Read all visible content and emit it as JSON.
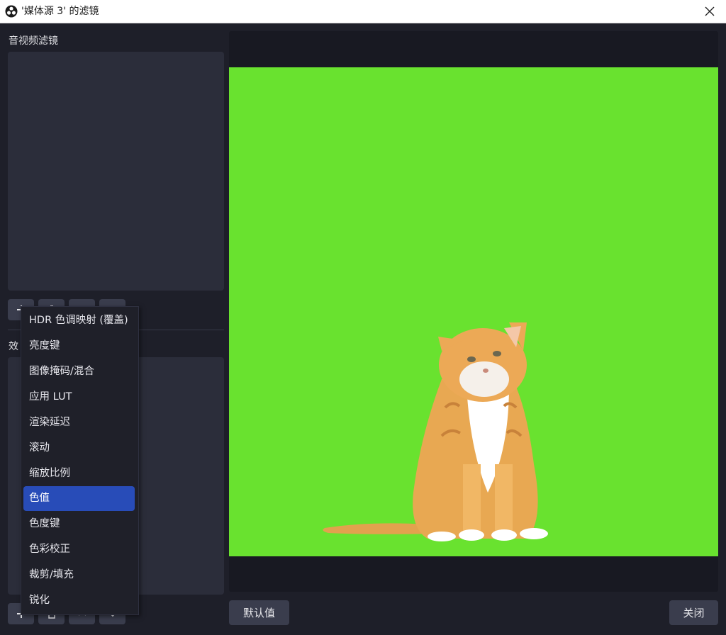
{
  "window": {
    "title": "'媒体源 3' 的滤镜",
    "app_icon": "obs-logo-icon",
    "close_icon": "close-icon"
  },
  "left_panel": {
    "av_filters_label": "音视频滤镜",
    "effects_label": "效",
    "top_buttons": [
      "plus-icon",
      "trash-icon",
      "up-icon",
      "down-icon"
    ],
    "bottom_buttons": [
      "plus-icon",
      "trash-icon",
      "up-icon",
      "down-icon"
    ]
  },
  "preview": {
    "background": "#69e22f",
    "subject": "kitten-image"
  },
  "buttons": {
    "defaults": "默认值",
    "close": "关闭"
  },
  "menu": {
    "items": [
      {
        "label": "HDR 色调映射 (覆盖)",
        "selected": false
      },
      {
        "label": "亮度键",
        "selected": false
      },
      {
        "label": "图像掩码/混合",
        "selected": false
      },
      {
        "label": "应用 LUT",
        "selected": false
      },
      {
        "label": "渲染延迟",
        "selected": false
      },
      {
        "label": "滚动",
        "selected": false
      },
      {
        "label": "缩放比例",
        "selected": false
      },
      {
        "label": "色值",
        "selected": true
      },
      {
        "label": "色度键",
        "selected": false
      },
      {
        "label": "色彩校正",
        "selected": false
      },
      {
        "label": "裁剪/填充",
        "selected": false
      },
      {
        "label": "锐化",
        "selected": false
      }
    ],
    "selected_color": "#284cb8"
  }
}
